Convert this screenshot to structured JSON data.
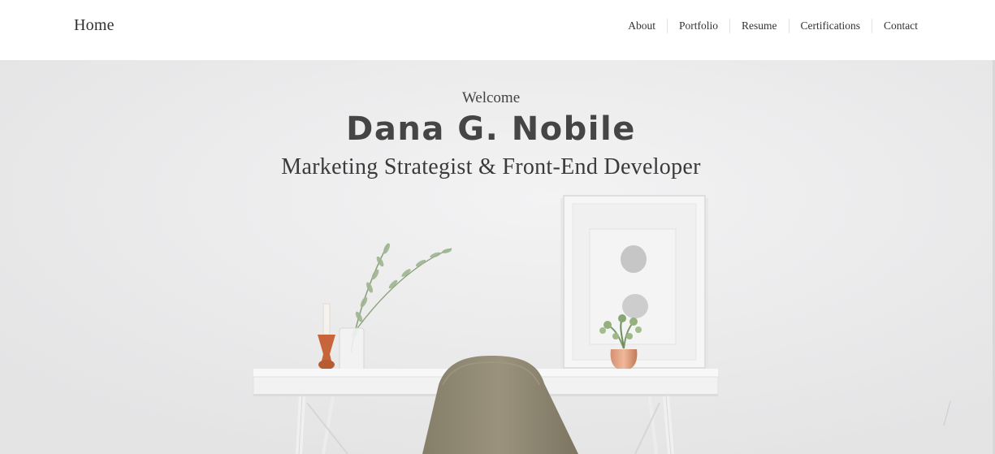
{
  "navbar": {
    "brand": "Home",
    "links": [
      "About",
      "Portfolio",
      "Resume",
      "Certifications",
      "Contact"
    ]
  },
  "hero": {
    "welcome": "Welcome",
    "name": "Dana G. Nobile",
    "role": "Marketing Strategist & Front-End Developer"
  },
  "colors": {
    "text": "#333333",
    "wall": "#ebebec",
    "chair": "#8e8670",
    "vase": "#c8643a"
  }
}
